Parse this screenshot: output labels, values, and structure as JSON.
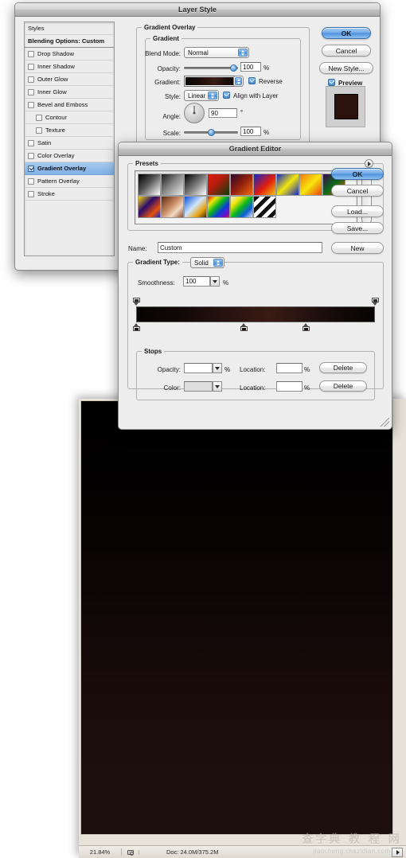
{
  "layer_style": {
    "title": "Layer Style",
    "styles_header": "Styles",
    "blending_options": "Blending Options: Custom",
    "effects": [
      {
        "label": "Drop Shadow",
        "checked": false,
        "sub": false,
        "selected": false
      },
      {
        "label": "Inner Shadow",
        "checked": false,
        "sub": false,
        "selected": false
      },
      {
        "label": "Outer Glow",
        "checked": false,
        "sub": false,
        "selected": false
      },
      {
        "label": "Inner Glow",
        "checked": false,
        "sub": false,
        "selected": false
      },
      {
        "label": "Bevel and Emboss",
        "checked": false,
        "sub": false,
        "selected": false
      },
      {
        "label": "Contour",
        "checked": false,
        "sub": true,
        "selected": false
      },
      {
        "label": "Texture",
        "checked": false,
        "sub": true,
        "selected": false
      },
      {
        "label": "Satin",
        "checked": false,
        "sub": false,
        "selected": false
      },
      {
        "label": "Color Overlay",
        "checked": false,
        "sub": false,
        "selected": false
      },
      {
        "label": "Gradient Overlay",
        "checked": true,
        "sub": false,
        "selected": true
      },
      {
        "label": "Pattern Overlay",
        "checked": false,
        "sub": false,
        "selected": false
      },
      {
        "label": "Stroke",
        "checked": false,
        "sub": false,
        "selected": false
      }
    ],
    "section_title": "Gradient Overlay",
    "group_title": "Gradient",
    "blend_mode_label": "Blend Mode:",
    "blend_mode_value": "Normal",
    "opacity_label": "Opacity:",
    "opacity_value": "100",
    "opacity_unit": "%",
    "gradient_label": "Gradient:",
    "reverse_label": "Reverse",
    "reverse_checked": true,
    "style_label": "Style:",
    "style_value": "Linear",
    "align_label": "Align with Layer",
    "align_checked": true,
    "angle_label": "Angle:",
    "angle_value": "90",
    "angle_unit": "°",
    "scale_label": "Scale:",
    "scale_value": "100",
    "scale_unit": "%",
    "buttons": {
      "ok": "OK",
      "cancel": "Cancel",
      "new_style": "New Style..."
    },
    "preview_label": "Preview",
    "preview_checked": true,
    "preview_swatch_color": "#2b120d",
    "gradient_swatch_css": "linear-gradient(to right,#070404 0%,#140a08 20%,#2e1511 45%,#3b1b15 58%,#1f100d 76%,#0a0505 100%)"
  },
  "gradient_editor": {
    "title": "Gradient Editor",
    "presets_label": "Presets",
    "presets": [
      {
        "name": "foreground-to-background",
        "css": "linear-gradient(135deg,#000 0%,#555 45%,#fff 100%)"
      },
      {
        "name": "foreground-to-transparent",
        "css": "linear-gradient(135deg,#1a1a1a 0%,#8d8d8d 50%,#e9e9e9 100%)"
      },
      {
        "name": "black-white",
        "css": "linear-gradient(135deg,#000 0%,#777 50%,#fff 100%)"
      },
      {
        "name": "red-green",
        "css": "linear-gradient(135deg,#e01b0c 0%,#b81c0e 40%,#0b3c0b 100%)"
      },
      {
        "name": "violet-orange",
        "css": "linear-gradient(135deg,#2b0b2b 0%,#8a1b10 45%,#f06a0b 100%)"
      },
      {
        "name": "blue-red-yellow",
        "css": "linear-gradient(135deg,#1426c8 0%,#e21b0c 55%,#f2c20c 100%)"
      },
      {
        "name": "blue-yellow-blue",
        "css": "linear-gradient(135deg,#1426c8 0%,#f2e60c 50%,#1426c8 100%)"
      },
      {
        "name": "orange-yellow-orange",
        "css": "linear-gradient(135deg,#f07a0b 0%,#f7e60c 50%,#e8420b 100%)"
      },
      {
        "name": "violet-green-orange",
        "css": "linear-gradient(135deg,#3a0b4a 0%,#0c6b1a 50%,#f2520b 100%)"
      },
      {
        "name": "yellow-violet-orange-blue",
        "css": "linear-gradient(135deg,#f2d40c 0%,#2b0b6b 40%,#e8520b 75%,#1426c8 100%)"
      },
      {
        "name": "copper",
        "css": "linear-gradient(135deg,#5a2a14 0%,#c98b63 45%,#f2d9c4 70%,#8a4a2a 100%)"
      },
      {
        "name": "chrome",
        "css": "linear-gradient(135deg,#0b4fd4 0%,#cfe4ff 45%,#e8a30b 75%,#3a2a10 100%)"
      },
      {
        "name": "spectrum",
        "css": "linear-gradient(135deg,#e21b0c 0%,#f2e60c 22%,#0cb81a 44%,#0c3cd8 66%,#7a0cc8 88%,#e21b0c 100%)"
      },
      {
        "name": "transparent-rainbow",
        "css": "linear-gradient(135deg,#e8e8e8 0%,#f2e60c 25%,#0cb81a 50%,#0c5cd8 75%,#e8e8e8 100%)"
      },
      {
        "name": "transparent-stripes",
        "css": "repeating-linear-gradient(135deg,#111 0 5px,#fff 5px 10px)"
      }
    ],
    "name_label": "Name:",
    "name_value": "Custom",
    "new_button": "New",
    "gradient_type_label": "Gradient Type:",
    "gradient_type_value": "Solid",
    "smoothness_label": "Smoothness:",
    "smoothness_value": "100",
    "smoothness_unit": "%",
    "gradient_bar_css": "linear-gradient(to right,#070404 0%,#110808 18%,#2c1410 42%,#3a1a14 56%,#241210 72%,#120908 86%,#070404 100%)",
    "opacity_stops": [
      {
        "position_pct": 0
      },
      {
        "position_pct": 100
      }
    ],
    "color_stops": [
      {
        "position_pct": 0
      },
      {
        "position_pct": 45
      },
      {
        "position_pct": 71
      }
    ],
    "stops_label": "Stops",
    "stop_opacity_label": "Opacity:",
    "stop_opacity_value": "",
    "stop_opacity_unit": "%",
    "stop_opacity_location_label": "Location:",
    "stop_opacity_location_value": "",
    "stop_opacity_location_unit": "%",
    "stop_color_label": "Color:",
    "stop_color_location_label": "Location:",
    "stop_color_location_value": "",
    "stop_color_location_unit": "%",
    "delete_button_1": "Delete",
    "delete_button_2": "Delete",
    "buttons": {
      "ok": "OK",
      "cancel": "Cancel",
      "load": "Load...",
      "save": "Save..."
    }
  },
  "document_window": {
    "zoom_level": "21.84%",
    "doc_info": "Doc: 24.0M/375.2M",
    "canvas_gradient_css": "linear-gradient(to bottom,#000000 0%,#090404 34%,#1a0c09 70%,#1d100c 100%)"
  },
  "watermark": {
    "chinese": "查字典 教 程 网",
    "url": "jiaocheng.chazidian.com"
  }
}
